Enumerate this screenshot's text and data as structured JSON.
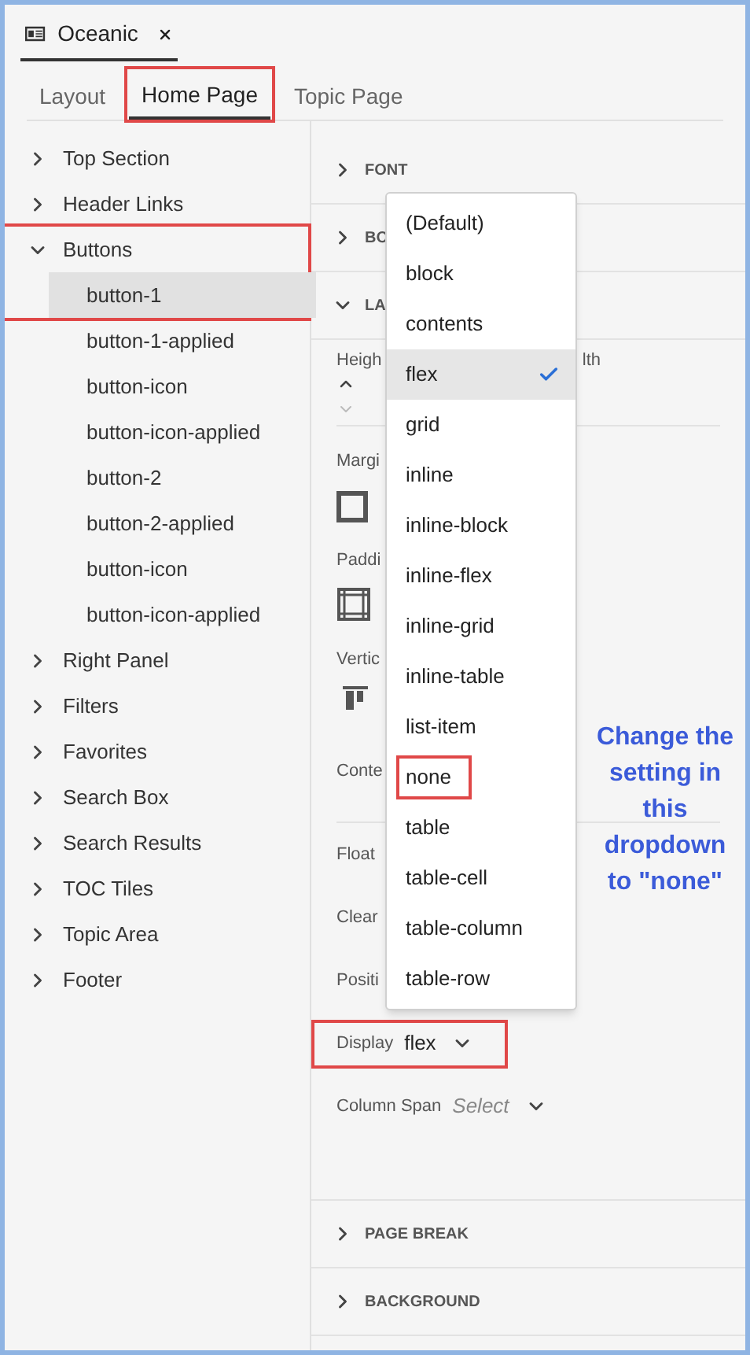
{
  "document_tab": {
    "title": "Oceanic"
  },
  "tabs": [
    {
      "label": "Layout",
      "selected": false,
      "highlighted": false
    },
    {
      "label": "Home Page",
      "selected": true,
      "highlighted": true
    },
    {
      "label": "Topic Page",
      "selected": false,
      "highlighted": false
    }
  ],
  "tree": [
    {
      "label": "Top Section",
      "expanded": false,
      "highlighted": false
    },
    {
      "label": "Header Links",
      "expanded": false,
      "highlighted": false
    },
    {
      "label": "Buttons",
      "expanded": true,
      "highlighted": true,
      "children": [
        {
          "label": "button-1",
          "selected": true
        },
        {
          "label": "button-1-applied",
          "selected": false
        },
        {
          "label": "button-icon",
          "selected": false
        },
        {
          "label": "button-icon-applied",
          "selected": false
        },
        {
          "label": "button-2",
          "selected": false
        },
        {
          "label": "button-2-applied",
          "selected": false
        },
        {
          "label": "button-icon",
          "selected": false
        },
        {
          "label": "button-icon-applied",
          "selected": false
        }
      ]
    },
    {
      "label": "Right Panel",
      "expanded": false,
      "highlighted": false
    },
    {
      "label": "Filters",
      "expanded": false,
      "highlighted": false
    },
    {
      "label": "Favorites",
      "expanded": false,
      "highlighted": false
    },
    {
      "label": "Search Box",
      "expanded": false,
      "highlighted": false
    },
    {
      "label": "Search Results",
      "expanded": false,
      "highlighted": false
    },
    {
      "label": "TOC Tiles",
      "expanded": false,
      "highlighted": false
    },
    {
      "label": "Topic Area",
      "expanded": false,
      "highlighted": false
    },
    {
      "label": "Footer",
      "expanded": false,
      "highlighted": false
    }
  ],
  "panel": [
    {
      "kind": "section",
      "title": "FONT",
      "expanded": false
    },
    {
      "kind": "section",
      "title": "BO",
      "expanded": false
    },
    {
      "kind": "section",
      "title": "LA",
      "expanded": true
    },
    {
      "kind": "stepper",
      "label": "Heigh",
      "label_2": "lth"
    },
    {
      "kind": "box-margin",
      "label": "Margi"
    },
    {
      "kind": "box-padding",
      "label": "Paddi"
    },
    {
      "kind": "align",
      "label": "Vertic"
    },
    {
      "kind": "label",
      "label": "Conte"
    },
    {
      "kind": "label",
      "label": "Float"
    },
    {
      "kind": "label",
      "label": "Clear"
    },
    {
      "kind": "label",
      "label": "Positi"
    },
    {
      "kind": "select",
      "label": "Display",
      "value": "flex",
      "highlighted": true
    },
    {
      "kind": "select",
      "label": "Column Span",
      "placeholder": "Select"
    },
    {
      "kind": "section",
      "title": "PAGE BREAK",
      "expanded": false
    },
    {
      "kind": "section",
      "title": "BACKGROUND",
      "expanded": false
    }
  ],
  "dropdown": {
    "options": [
      {
        "label": "(Default)",
        "selected": false,
        "highlighted": false
      },
      {
        "label": "block",
        "selected": false,
        "highlighted": false
      },
      {
        "label": "contents",
        "selected": false,
        "highlighted": false
      },
      {
        "label": "flex",
        "selected": true,
        "highlighted": false
      },
      {
        "label": "grid",
        "selected": false,
        "highlighted": false
      },
      {
        "label": "inline",
        "selected": false,
        "highlighted": false
      },
      {
        "label": "inline-block",
        "selected": false,
        "highlighted": false
      },
      {
        "label": "inline-flex",
        "selected": false,
        "highlighted": false
      },
      {
        "label": "inline-grid",
        "selected": false,
        "highlighted": false
      },
      {
        "label": "inline-table",
        "selected": false,
        "highlighted": false
      },
      {
        "label": "list-item",
        "selected": false,
        "highlighted": false
      },
      {
        "label": "none",
        "selected": false,
        "highlighted": true
      },
      {
        "label": "table",
        "selected": false,
        "highlighted": false
      },
      {
        "label": "table-cell",
        "selected": false,
        "highlighted": false
      },
      {
        "label": "table-column",
        "selected": false,
        "highlighted": false
      },
      {
        "label": "table-row",
        "selected": false,
        "highlighted": false
      }
    ]
  },
  "annotation": {
    "text": "Change the setting in this dropdown to \"none\""
  }
}
